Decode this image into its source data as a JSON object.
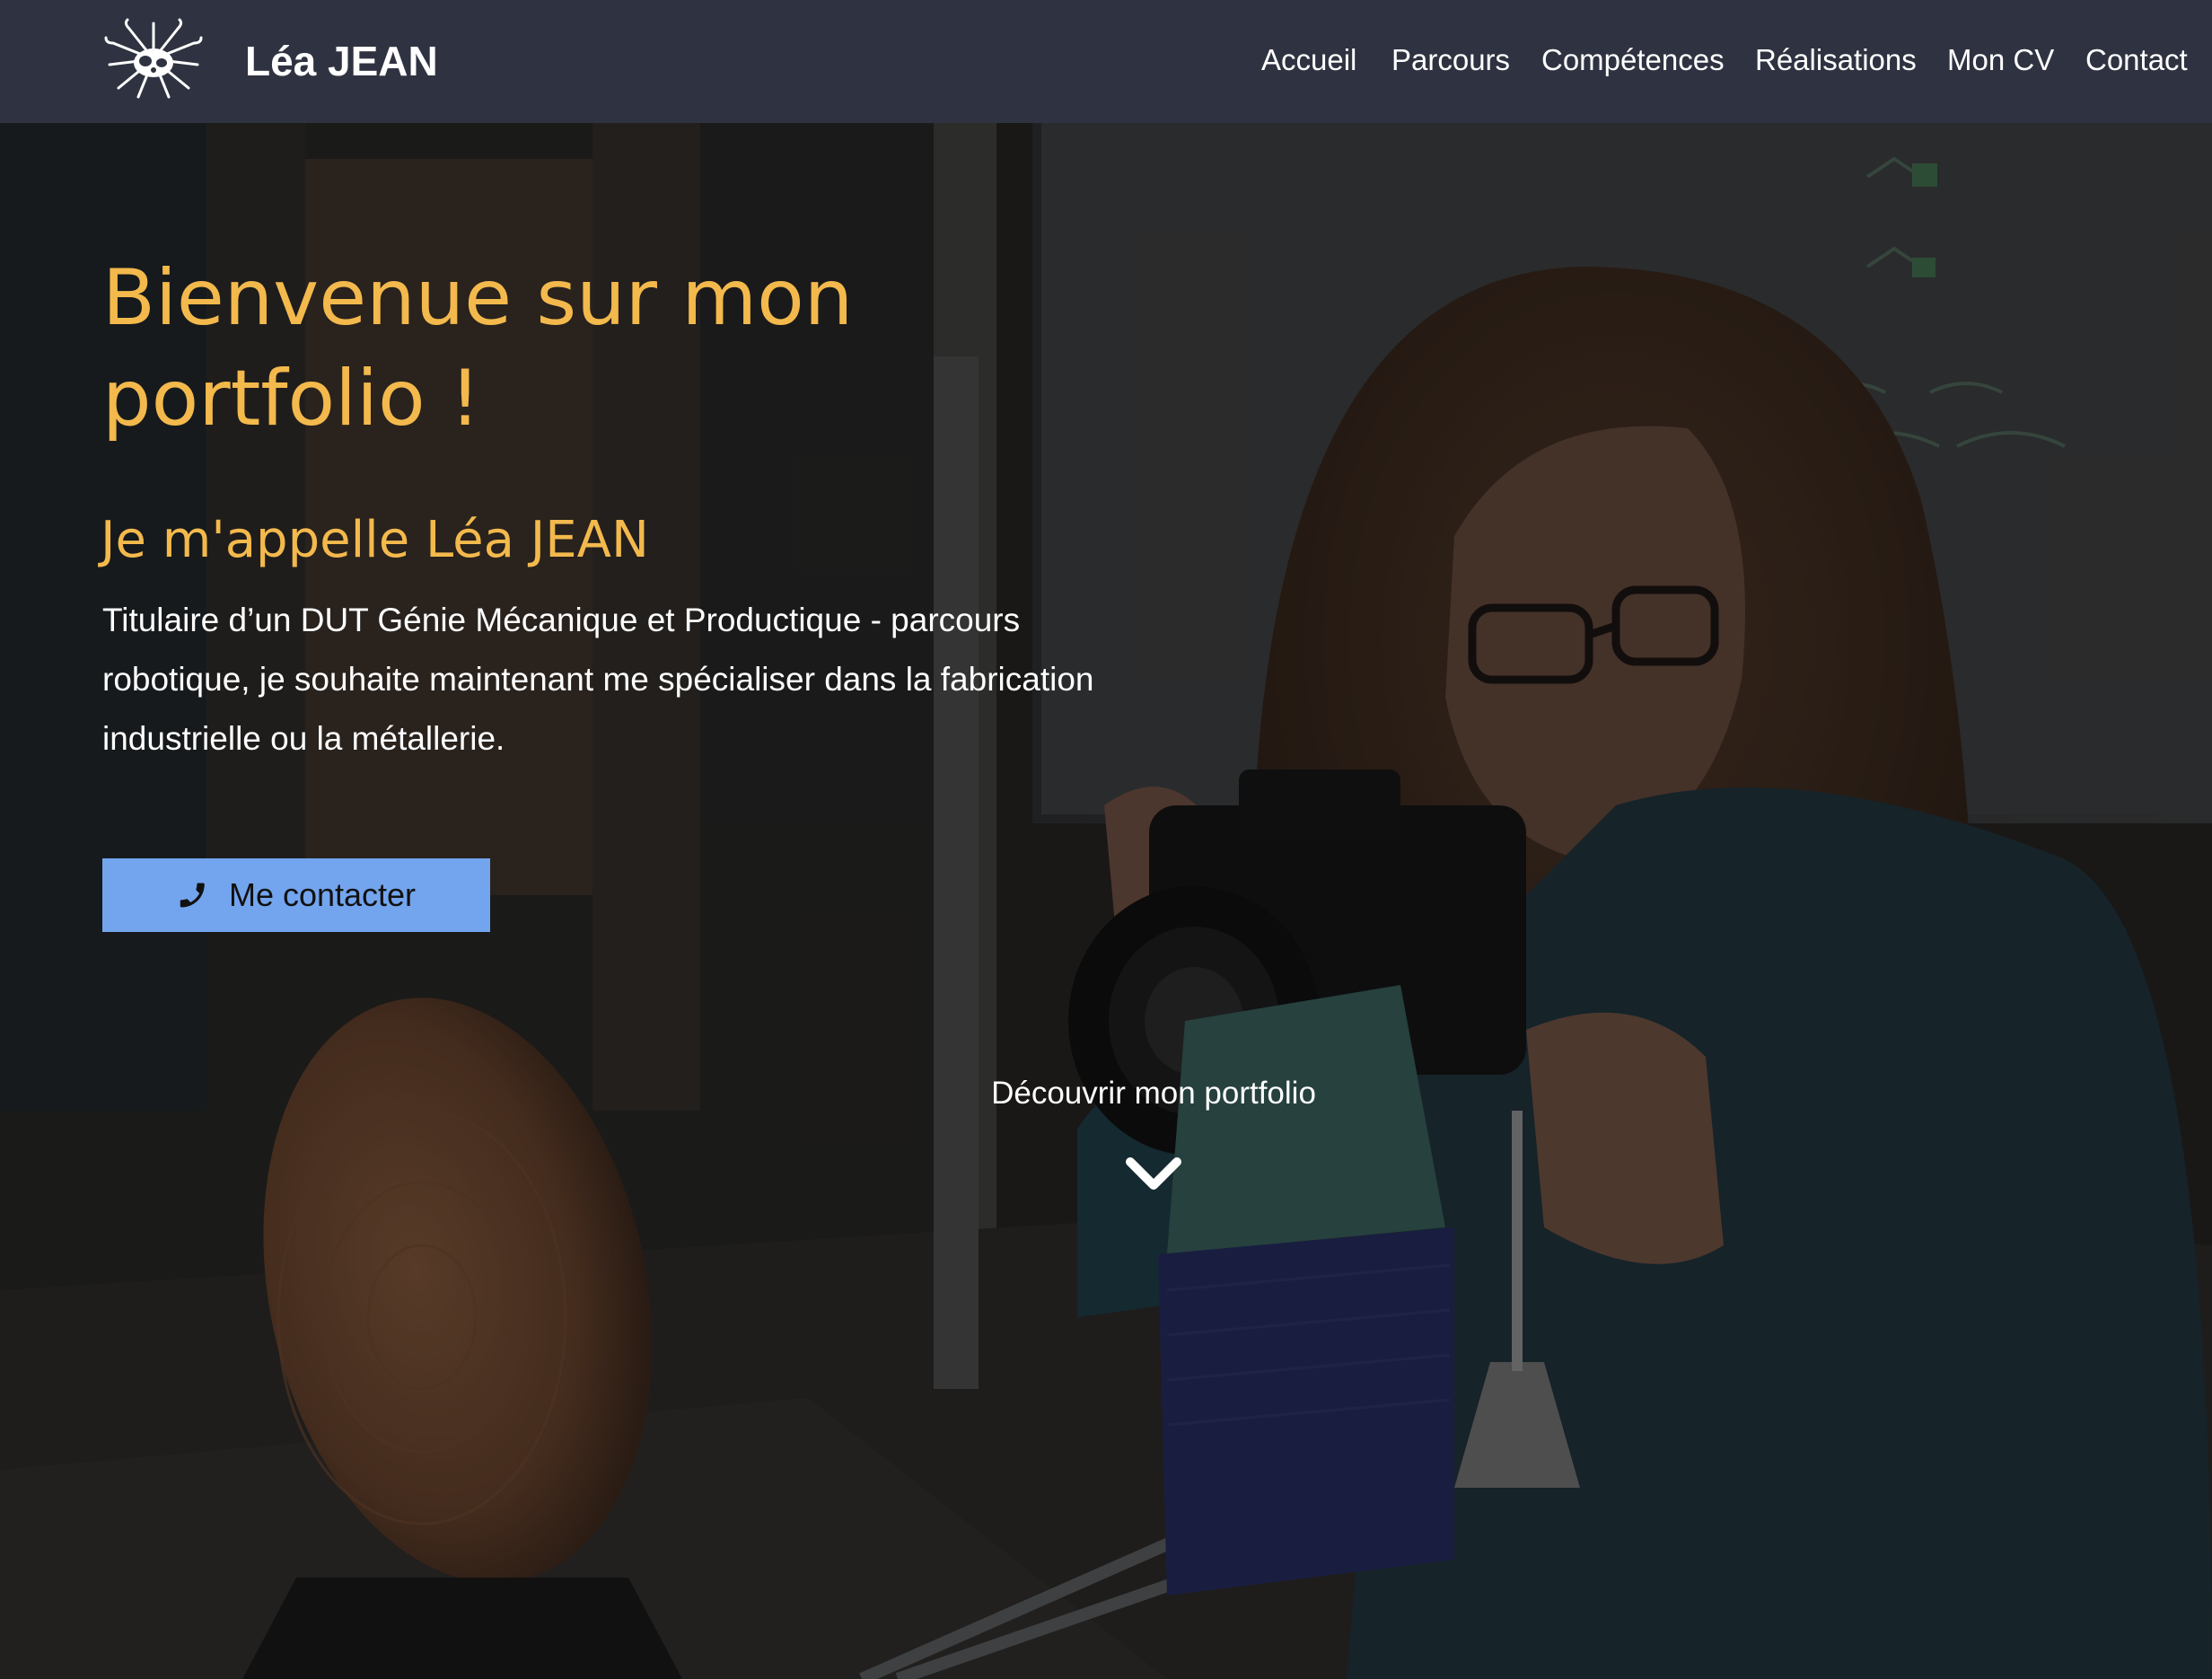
{
  "brand": {
    "name": "Léa JEAN",
    "logo_icon": "flower-logo-icon"
  },
  "nav": {
    "items": [
      {
        "label": "Accueil"
      },
      {
        "label": "Parcours"
      },
      {
        "label": "Compétences"
      },
      {
        "label": "Réalisations"
      },
      {
        "label": "Mon CV"
      },
      {
        "label": "Contact"
      }
    ]
  },
  "hero": {
    "title": "Bienvenue sur mon portfolio !",
    "subtitle": "Je m'appelle Léa JEAN",
    "description": "Titulaire d’un DUT Génie Mécanique et Productique - parcours robotique, je souhaite maintenant me spécialiser dans la fabrication industrielle ou la métallerie.",
    "cta": {
      "label": "Me contacter",
      "icon": "phone-icon"
    },
    "discover": {
      "label": "Découvrir mon portfolio",
      "icon": "chevron-down-icon"
    }
  },
  "colors": {
    "navbar_bg": "#2f3341",
    "accent_title": "#f3b94c",
    "cta_bg": "#73a5ee",
    "text_light": "#ffffff"
  }
}
